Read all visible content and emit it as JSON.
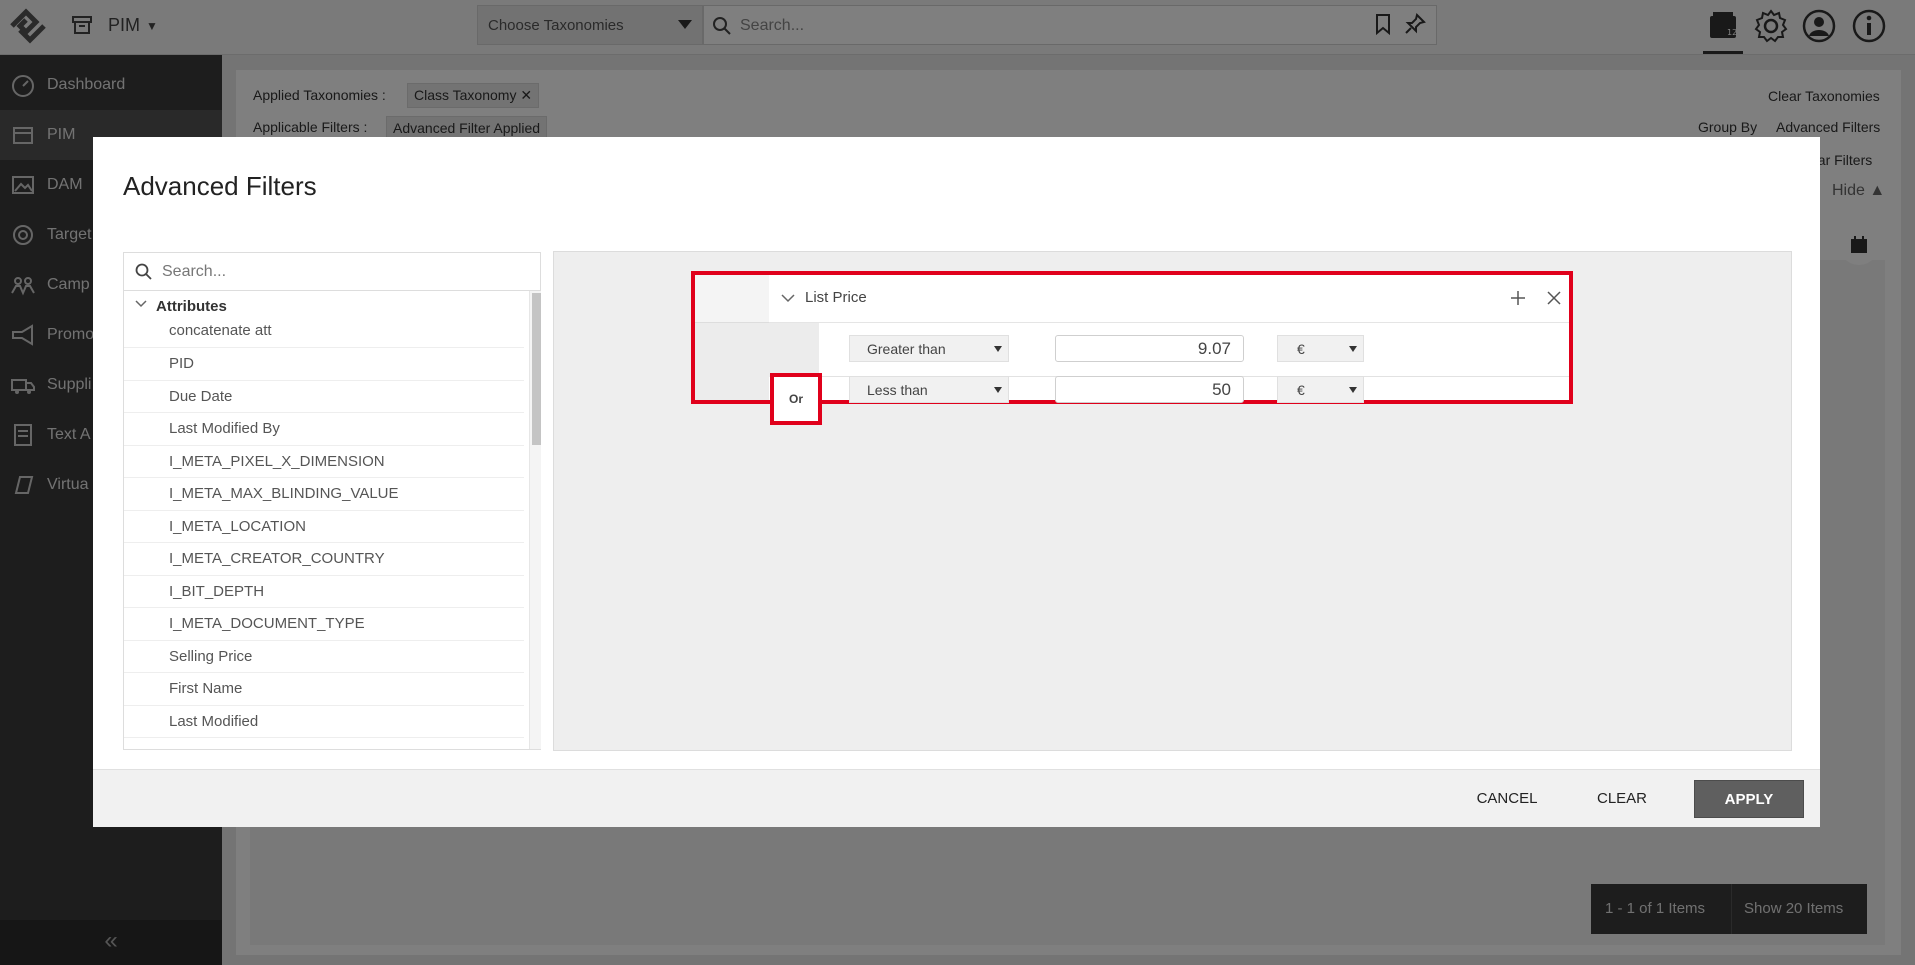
{
  "topbar": {
    "app_name": "PIM",
    "taxonomy_select": "Choose Taxonomies",
    "search_placeholder": "Search..."
  },
  "sidebar": {
    "items": [
      {
        "label": "Dashboard",
        "icon": "gauge-icon"
      },
      {
        "label": "PIM",
        "icon": "box-icon"
      },
      {
        "label": "DAM",
        "icon": "image-icon"
      },
      {
        "label": "Target",
        "icon": "target-icon"
      },
      {
        "label": "Camp",
        "icon": "people-icon"
      },
      {
        "label": "Promo",
        "icon": "megaphone-icon"
      },
      {
        "label": "Suppli",
        "icon": "truck-icon"
      },
      {
        "label": "Text A",
        "icon": "document-icon"
      },
      {
        "label": "Virtua",
        "icon": "cube-icon"
      }
    ],
    "collapse_label": "«"
  },
  "background": {
    "applied_taxonomies_label": "Applied Taxonomies :",
    "applied_taxonomy_chip": "Class Taxonomy",
    "applicable_filters_label": "Applicable Filters :",
    "applicable_filter_chip": "Advanced Filter Applied",
    "clear_taxonomies": "Clear Taxonomies",
    "group_by_label": "Group By",
    "group_by_value": "Advanced Filters",
    "clear_filters": "ear Filters",
    "hide_label": "Hide ▲",
    "pager_range": "1 - 1 of 1 Items",
    "pager_show": "Show 20 Items"
  },
  "modal": {
    "title": "Advanced Filters",
    "search_placeholder": "Search...",
    "tree_title": "Attributes",
    "attributes": [
      "concatenate att",
      "PID",
      "Due Date",
      "Last Modified By",
      "I_META_PIXEL_X_DIMENSION",
      "I_META_MAX_BLINDING_VALUE",
      "I_META_LOCATION",
      "I_META_CREATOR_COUNTRY",
      "I_BIT_DEPTH",
      "I_META_DOCUMENT_TYPE",
      "Selling Price",
      "First Name",
      "Last Modified"
    ],
    "filter_group": {
      "title": "List Price",
      "or_label": "Or",
      "conditions": [
        {
          "operator": "Greater than",
          "value": "9.07",
          "currency": "€"
        },
        {
          "operator": "Less than",
          "value": "50",
          "currency": "€"
        }
      ]
    },
    "footer": {
      "cancel": "CANCEL",
      "clear": "CLEAR",
      "apply": "APPLY"
    }
  }
}
